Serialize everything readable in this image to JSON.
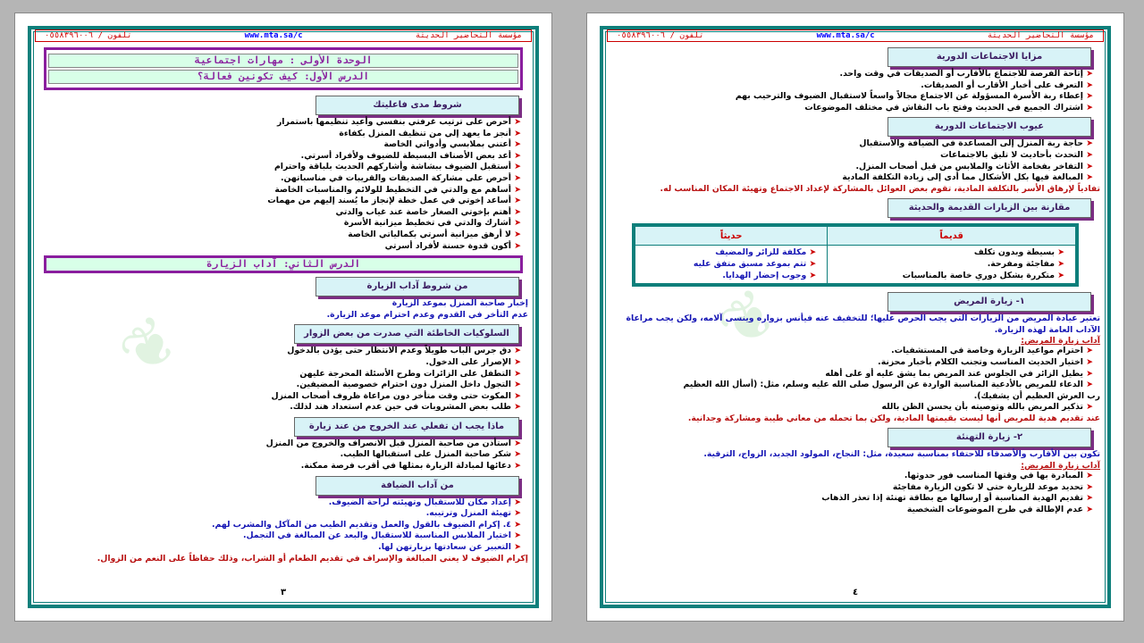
{
  "header": {
    "title": "مؤسسة التحاضير الحديثة",
    "website": "www.mta.sa/c",
    "phone": "تلفون / ٠٥٥٨٣٩٦٠٠٦"
  },
  "left": {
    "unit": "الوحدة الأولى : مهارات اجتماعية",
    "lesson1": "الدرس الأول: كيف تكونين فعالة؟",
    "s1": {
      "title": "شروط مدى فاعليتك",
      "items": [
        "أحرص على ترتيب غرفتي بنفسي وأعيد تنظيمها باستمرار",
        "أنجز ما يعهد إلي من تنظيف المنزل بكفاءة",
        "أعتني بملابسي وأدواتي الخاصة",
        "أعد بعض الأصناف البسيطة للضيوف ولأفراد أسرتي.",
        "أستقبل الضيوف ببشاشة وأشاركهم الحديث بلباقة واحترام",
        "أحرص على مشاركة الصديقات والقريبات في مناسباتهن.",
        "أساهم مع والدتي في التخطيط للولائم والمناسبات الخاصة",
        "أساعد إخوتي في عمل خطة لإنجاز ما يُسند إليهم من مهمات",
        "أهتم بإخوتي الصغار خاصة عند غياب والدتي",
        "أشارك والدتي في تخطيط ميزانية الأسرة",
        "لا أرهق ميزانية أسرتي بكمالياتي الخاصة",
        "أكون قدوة حسنة لأفراد أسرتي"
      ]
    },
    "lesson2": "الدرس الثاني: آداب الزيارة",
    "s2": {
      "title": "من شروط آداب الزيارة",
      "lines": [
        "إخبار صاحبة المنزل بموعد الزيارة",
        "عدم التأخر في القدوم وعدم احترام موعد الزيارة."
      ]
    },
    "s3": {
      "title": "السلوكيات الخاطئة التي صدرت من بعض الزوار",
      "items": [
        "دق جرس الباب طويلاً وعدم الانتظار حتى يؤذن بالدخول",
        "الإصرار على الدخول.",
        "التطفل على الزائرات وطرح الأسئلة المحرجة عليهن",
        "التجول داخل المنزل دون احترام خصوصية المضيفين.",
        "المكوث حتى وقت متأخر دون مراعاة ظروف أصحاب المنزل",
        "طلب بعض المشروبات في حين عدم استعداد هند لذلك."
      ]
    },
    "s4": {
      "title": "ماذا يجب ان تفعلي عند الخروج من عند زيارة",
      "items": [
        "استأذن من صاحبة المنزل قبل الانصراف والخروج من المنزل",
        "شكر صاحبة المنزل على استقبالها الطيب.",
        "دعائها لمبادلة الزيارة بمثلها في أقرب فرصة ممكنة."
      ]
    },
    "s5": {
      "title": "من آداب الضيافة",
      "items": [
        "إعداد مكان للاستقبال وتهيئته لراحة الضيوف.",
        "تهيئة المنزل وترتيبه.",
        "٤. إكرام الضيوف بالقول والعمل وتقديم الطيب من المآكل والمشرب لهم.",
        "اختيار الملابس المناسبة للاستقبال والبعد عن المبالغة في التجمل.",
        "التعبير عن سعادتها بزيارتهن لها."
      ],
      "note": "إكرام الضيوف لا يعني المبالغة والإسراف في تقديم الطعام أو الشراب، وذلك حفاظاً على النعم من الزوال."
    },
    "page_number": "٣"
  },
  "right": {
    "s1": {
      "title": "مزايا الاجتماعات الدورية",
      "items": [
        "إتاحة الفرصة للاجتماع بالأقارب أو الصديقات في وقت واحد.",
        "التعرف على أخبار الأقارب أو الصديقات.",
        "إعطاء ربة الأسرة المسؤولة عن الاجتماع مجالاً واسعاً لاستقبال الضيوف والترحيب بهم",
        "اشتراك الجميع في الحديث وفتح باب النقاش في مختلف الموضوعات"
      ]
    },
    "s2": {
      "title": "عيوب الاجتماعات الدورية",
      "items": [
        "حاجة ربة المنزل إلى المساعدة في الضيافة والاستقبال",
        "التحدث بأحاديث لا تليق بالاجتماعات",
        "التفاخر بفخامة الأثاث والملابس من قبل أصحاب المنزل.",
        "المبالغة فيها بكل الأشكال مما أدى إلى زيادة التكلفة المادية"
      ],
      "note": "تفادياً لإرهاق الأسر بالتكلفة المادية، تقوم بعض العوائل بالمشاركة لإعداد الاجتماع وتهيئة المكان المناسب له."
    },
    "s3": {
      "title": "مقارنة بين الزيارات القديمة والحديثة"
    },
    "table": {
      "head_old": "قديماً",
      "head_new": "حديثاً",
      "old": [
        "بسيطة وبدون تكلف",
        "مفاجئة ومفرحة.",
        "متكررة بشكل دوري خاصة بالمناسبات"
      ],
      "new": [
        "مكلفة للزائر والمضيف",
        "تتم بموعد مسبق متفق عليه",
        "وجوب إحضار الهدايا."
      ]
    },
    "s4": {
      "title": "١- زيارة المريض",
      "intro": "تعتبر عيادة المريض من الزيارات التي يجب الحرص عليها؛ للتخفيف عنه فيأنس بزواره وينسى آلامه، ولكن يجب مراعاة الآداب العامة لهذه الزيارة.",
      "sub": "آداب زيارة المريض:",
      "items": [
        "احترام مواعيد الزيارة وخاصة في المستشفيات.",
        "اختيار الحديث المناسب وتجنب الكلام بأخبار محزنة.",
        "يطيل الزائر في الجلوس عند المريض بما يشق عليه أو على أهله",
        "الدعاء للمريض بالأدعية المناسبة الواردة عن الرسول صلى الله عليه وسلم، مثل: (أسأل الله العظيم",
        "تذكير المريض بالله وتوصيته بأن يحسن الظن بالله"
      ],
      "cont": "رب العرش العظيم أن يشفيك).",
      "note": "عند تقديم هدية للمريض أنها ليست بقيمتها المادية، ولكن بما تحمله من معاني طيبة ومشاركة وجدانية."
    },
    "s5": {
      "title": "٢- زيارة التهنئة",
      "intro": "تكون بين الأقارب والأصدقاء للاحتفاء بمناسبة سعيدة، مثل: النجاح، المولود الجديد، الزواج، الترقية.",
      "sub": "آداب زيارة المريض:",
      "items": [
        "المبادرة بها في وقتها المناسب فور حدوثها.",
        "تحديد موعد للزيارة حتى لا تكون الزيارة مفاجئة",
        "تقديم الهدية المناسبة أو إرسالها مع بطاقة تهنئة إذا تعذر الذهاب",
        "عدم الإطالة في طرح الموضوعات الشخصية"
      ]
    },
    "page_number": "٤"
  }
}
